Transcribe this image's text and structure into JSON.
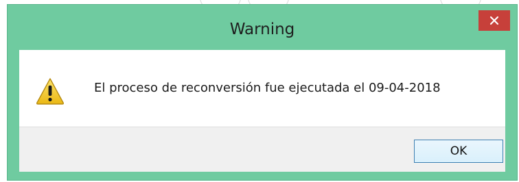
{
  "dialog": {
    "title": "Warning",
    "close_symbol": "✕",
    "icon": "warning-icon",
    "message": "El proceso de reconversión fue ejecutada el 09-04-2018",
    "ok_label": "OK"
  },
  "colors": {
    "titlebar": "#6fcba0",
    "close_button": "#c7403a",
    "warning_yellow": "#f4c81f",
    "ok_border": "#3c7fb1"
  }
}
